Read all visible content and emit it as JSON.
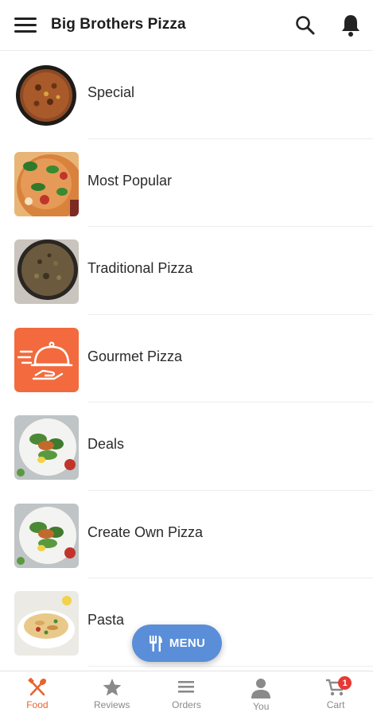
{
  "appbar": {
    "title": "Big Brothers Pizza",
    "menu_icon": "hamburger-menu-icon",
    "search_icon": "search-icon",
    "notification_icon": "bell-icon"
  },
  "categories": [
    {
      "label": "Special",
      "thumb": "pizza-special-photo"
    },
    {
      "label": "Most Popular",
      "thumb": "pizza-basil-photo"
    },
    {
      "label": "Traditional Pizza",
      "thumb": "pizza-traditional-photo"
    },
    {
      "label": "Gourmet Pizza",
      "thumb": "serving-cloche-icon"
    },
    {
      "label": "Deals",
      "thumb": "salad-plate-photo"
    },
    {
      "label": "Create Own Pizza",
      "thumb": "salad-plate-photo"
    },
    {
      "label": "Pasta",
      "thumb": "pasta-bowl-photo"
    }
  ],
  "fab": {
    "label": "MENU",
    "icon": "fork-knife-icon"
  },
  "bottom_nav": [
    {
      "label": "Food",
      "icon": "food-utensils-icon",
      "active": true
    },
    {
      "label": "Reviews",
      "icon": "star-icon",
      "active": false
    },
    {
      "label": "Orders",
      "icon": "list-icon",
      "active": false
    },
    {
      "label": "You",
      "icon": "person-icon",
      "active": false
    },
    {
      "label": "Cart",
      "icon": "cart-icon",
      "active": false,
      "badge": "1"
    }
  ],
  "colors": {
    "accent": "#e8632d",
    "fab": "#5b8ed8",
    "badge": "#e53935",
    "gourmet_tile": "#f26a3d"
  }
}
